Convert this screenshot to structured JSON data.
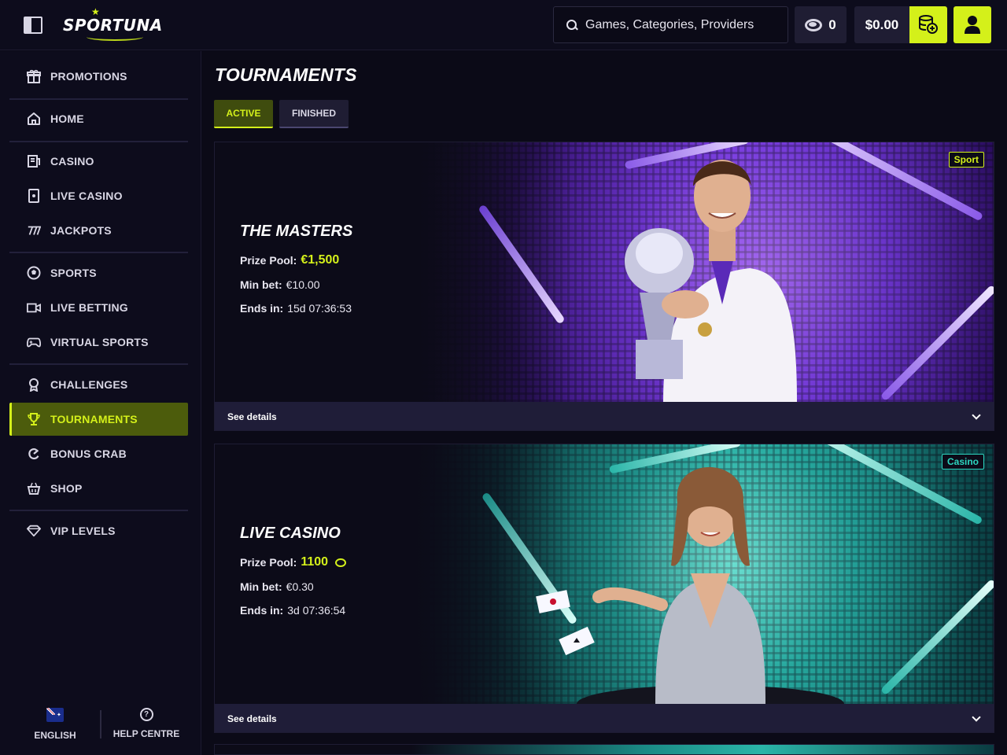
{
  "header": {
    "logo_text": "SPORTUNA",
    "search_placeholder": "Games, Categories, Providers",
    "coins": "0",
    "balance": "$0.00"
  },
  "sidebar": {
    "items": [
      {
        "label": "PROMOTIONS",
        "icon": "gift-icon"
      },
      {
        "label": "HOME",
        "icon": "home-icon"
      },
      {
        "label": "CASINO",
        "icon": "casino-icon"
      },
      {
        "label": "LIVE CASINO",
        "icon": "live-casino-icon"
      },
      {
        "label": "JACKPOTS",
        "icon": "jackpot-icon"
      },
      {
        "label": "SPORTS",
        "icon": "soccer-ball-icon"
      },
      {
        "label": "LIVE BETTING",
        "icon": "video-icon"
      },
      {
        "label": "VIRTUAL SPORTS",
        "icon": "gamepad-icon"
      },
      {
        "label": "CHALLENGES",
        "icon": "medal-icon"
      },
      {
        "label": "TOURNAMENTS",
        "icon": "trophy-icon"
      },
      {
        "label": "BONUS CRAB",
        "icon": "bonus-crab-icon"
      },
      {
        "label": "SHOP",
        "icon": "basket-icon"
      },
      {
        "label": "VIP LEVELS",
        "icon": "diamond-icon"
      }
    ],
    "active": "TOURNAMENTS",
    "language": "ENGLISH",
    "help": "HELP CENTRE"
  },
  "main": {
    "title": "TOURNAMENTS",
    "tabs": [
      {
        "label": "ACTIVE",
        "active": true
      },
      {
        "label": "FINISHED",
        "active": false
      }
    ],
    "cards": [
      {
        "name": "THE MASTERS",
        "tag": "Sport",
        "prize_label": "Prize Pool:",
        "prize": "€1,500",
        "minbet_label": "Min bet:",
        "minbet": "€10.00",
        "ends_label": "Ends in:",
        "ends": "15d 07:36:53",
        "details": "See details"
      },
      {
        "name": "LIVE CASINO",
        "tag": "Casino",
        "prize_label": "Prize Pool:",
        "prize": "1100",
        "minbet_label": "Min bet:",
        "minbet": "€0.30",
        "ends_label": "Ends in:",
        "ends": "3d 07:36:54",
        "details": "See details"
      }
    ]
  },
  "colors": {
    "accent": "#d4f01a",
    "background": "#0b0a17",
    "panel": "#1f1d33",
    "casino_tag": "#2dd6c0"
  }
}
